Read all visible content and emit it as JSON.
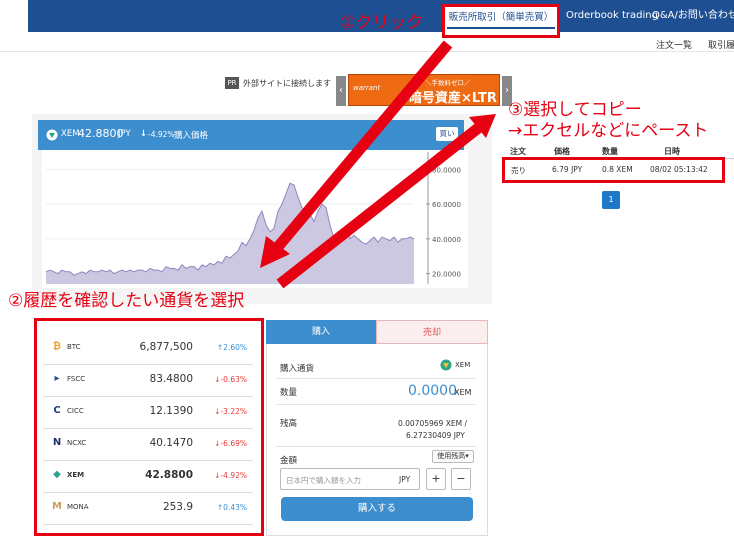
{
  "nav": {
    "simple_trade": "販売所取引（簡単売買）",
    "orderbook": "Orderbook trading",
    "qa": "Q&A/お問い合わせ"
  },
  "subnav": {
    "order_list": "注文一覧",
    "history": "取引履"
  },
  "annotations": {
    "step1": "①クリック",
    "step2": "②履歴を確認したい通貨を選択",
    "step3_line1": "③選択してコピー",
    "step3_line2": "→エクセルなどにペースト",
    "color": "#e60012"
  },
  "ad": {
    "pr_badge": "PR",
    "notice": "外部サイトに接続します",
    "logo": "warrant",
    "top_line": "＼手数料ゼロ／",
    "main_line": "暗号資産×LTR",
    "prev_icon": "chevron-left-icon",
    "next_icon": "chevron-right-icon"
  },
  "ticker": {
    "symbol": "XEM",
    "price": "42.8800",
    "currency": "JPY",
    "change": "-4.92%",
    "label": "購入価格",
    "buy_label": "買い"
  },
  "chart_data": {
    "type": "area",
    "title": "",
    "xlabel": "",
    "ylabel": "",
    "y_tick_labels": [
      "80.0000",
      "60.0000",
      "40.0000",
      "20.0000"
    ],
    "ylim": [
      14,
      90
    ],
    "series": [
      {
        "values": [
          21,
          22,
          21,
          20,
          22,
          21,
          21,
          19,
          20,
          21,
          20,
          22,
          21,
          21,
          22,
          21,
          22,
          20,
          21,
          22,
          21,
          22,
          21,
          22,
          22,
          21,
          23,
          22,
          22,
          21,
          24,
          23,
          23,
          22,
          25,
          23,
          24,
          24,
          22,
          25,
          24,
          26,
          25,
          27,
          26,
          30,
          29,
          31,
          33,
          38,
          36,
          40,
          45,
          52,
          56,
          48,
          44,
          46,
          56,
          60,
          66,
          72,
          71,
          64,
          58,
          56,
          54,
          50,
          56,
          60,
          58,
          48,
          40,
          44,
          42,
          47,
          40,
          42,
          40,
          38,
          37,
          39,
          41,
          38,
          41,
          40,
          39,
          41,
          38,
          40,
          40,
          41,
          40
        ]
      }
    ],
    "fill_color": "#cdc8e2",
    "line_color": "#8f86bf"
  },
  "history": {
    "headers": [
      "注文",
      "価格",
      "数量",
      "日時"
    ],
    "rows": [
      [
        "売り",
        "6.79 JPY",
        "0.8 XEM",
        "08/02 05:13:42"
      ]
    ],
    "page": "1"
  },
  "currencies": [
    {
      "symbol": "BTC",
      "price": "6,877,500",
      "change": "2.60%",
      "dir": "up",
      "icon": "bitcoin-icon",
      "glyph": "₿",
      "color": "#f2a51d"
    },
    {
      "symbol": "FSCC",
      "price": "83.4800",
      "change": "-0.63%",
      "dir": "down",
      "icon": "fscc-icon",
      "glyph": "▸",
      "color": "#1e4f92"
    },
    {
      "symbol": "CICC",
      "price": "12.1390",
      "change": "-3.22%",
      "dir": "down",
      "icon": "cicc-icon",
      "glyph": "C",
      "color": "#1e3f82"
    },
    {
      "symbol": "NCXC",
      "price": "40.1470",
      "change": "-6.69%",
      "dir": "down",
      "icon": "ncxc-icon",
      "glyph": "N",
      "color": "#223366"
    },
    {
      "symbol": "XEM",
      "price": "42.8800",
      "change": "-4.92%",
      "dir": "down",
      "icon": "xem-icon",
      "glyph": "◆",
      "color": "#2aa48c"
    },
    {
      "symbol": "MONA",
      "price": "253.9",
      "change": "0.43%",
      "dir": "up",
      "icon": "mona-icon",
      "glyph": "M",
      "color": "#c8a060"
    }
  ],
  "trade": {
    "tab_buy": "購入",
    "tab_sell": "売却",
    "currency_label": "購入通貨",
    "currency_value": "XEM",
    "qty_label": "数量",
    "qty_value": "0.0000",
    "qty_unit": "XEM",
    "balance_label": "残高",
    "balance_line1": "0.00705969 XEM /",
    "balance_line2": "6.27230409 JPY",
    "amount_label": "金額",
    "use_balance": "使用残高▾",
    "amount_placeholder": "日本円で購入額を入力",
    "amount_unit": "JPY",
    "plus": "+",
    "minus": "−",
    "submit": "購入する"
  }
}
